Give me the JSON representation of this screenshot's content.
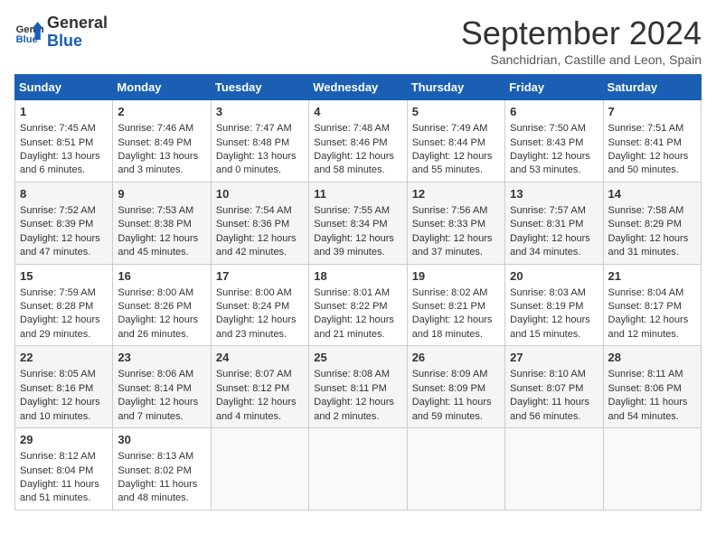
{
  "header": {
    "logo_line1": "General",
    "logo_line2": "Blue",
    "month_title": "September 2024",
    "subtitle": "Sanchidrian, Castille and Leon, Spain"
  },
  "days_of_week": [
    "Sunday",
    "Monday",
    "Tuesday",
    "Wednesday",
    "Thursday",
    "Friday",
    "Saturday"
  ],
  "weeks": [
    [
      {
        "day": "1",
        "sunrise": "Sunrise: 7:45 AM",
        "sunset": "Sunset: 8:51 PM",
        "daylight": "Daylight: 13 hours and 6 minutes."
      },
      {
        "day": "2",
        "sunrise": "Sunrise: 7:46 AM",
        "sunset": "Sunset: 8:49 PM",
        "daylight": "Daylight: 13 hours and 3 minutes."
      },
      {
        "day": "3",
        "sunrise": "Sunrise: 7:47 AM",
        "sunset": "Sunset: 8:48 PM",
        "daylight": "Daylight: 13 hours and 0 minutes."
      },
      {
        "day": "4",
        "sunrise": "Sunrise: 7:48 AM",
        "sunset": "Sunset: 8:46 PM",
        "daylight": "Daylight: 12 hours and 58 minutes."
      },
      {
        "day": "5",
        "sunrise": "Sunrise: 7:49 AM",
        "sunset": "Sunset: 8:44 PM",
        "daylight": "Daylight: 12 hours and 55 minutes."
      },
      {
        "day": "6",
        "sunrise": "Sunrise: 7:50 AM",
        "sunset": "Sunset: 8:43 PM",
        "daylight": "Daylight: 12 hours and 53 minutes."
      },
      {
        "day": "7",
        "sunrise": "Sunrise: 7:51 AM",
        "sunset": "Sunset: 8:41 PM",
        "daylight": "Daylight: 12 hours and 50 minutes."
      }
    ],
    [
      {
        "day": "8",
        "sunrise": "Sunrise: 7:52 AM",
        "sunset": "Sunset: 8:39 PM",
        "daylight": "Daylight: 12 hours and 47 minutes."
      },
      {
        "day": "9",
        "sunrise": "Sunrise: 7:53 AM",
        "sunset": "Sunset: 8:38 PM",
        "daylight": "Daylight: 12 hours and 45 minutes."
      },
      {
        "day": "10",
        "sunrise": "Sunrise: 7:54 AM",
        "sunset": "Sunset: 8:36 PM",
        "daylight": "Daylight: 12 hours and 42 minutes."
      },
      {
        "day": "11",
        "sunrise": "Sunrise: 7:55 AM",
        "sunset": "Sunset: 8:34 PM",
        "daylight": "Daylight: 12 hours and 39 minutes."
      },
      {
        "day": "12",
        "sunrise": "Sunrise: 7:56 AM",
        "sunset": "Sunset: 8:33 PM",
        "daylight": "Daylight: 12 hours and 37 minutes."
      },
      {
        "day": "13",
        "sunrise": "Sunrise: 7:57 AM",
        "sunset": "Sunset: 8:31 PM",
        "daylight": "Daylight: 12 hours and 34 minutes."
      },
      {
        "day": "14",
        "sunrise": "Sunrise: 7:58 AM",
        "sunset": "Sunset: 8:29 PM",
        "daylight": "Daylight: 12 hours and 31 minutes."
      }
    ],
    [
      {
        "day": "15",
        "sunrise": "Sunrise: 7:59 AM",
        "sunset": "Sunset: 8:28 PM",
        "daylight": "Daylight: 12 hours and 29 minutes."
      },
      {
        "day": "16",
        "sunrise": "Sunrise: 8:00 AM",
        "sunset": "Sunset: 8:26 PM",
        "daylight": "Daylight: 12 hours and 26 minutes."
      },
      {
        "day": "17",
        "sunrise": "Sunrise: 8:00 AM",
        "sunset": "Sunset: 8:24 PM",
        "daylight": "Daylight: 12 hours and 23 minutes."
      },
      {
        "day": "18",
        "sunrise": "Sunrise: 8:01 AM",
        "sunset": "Sunset: 8:22 PM",
        "daylight": "Daylight: 12 hours and 21 minutes."
      },
      {
        "day": "19",
        "sunrise": "Sunrise: 8:02 AM",
        "sunset": "Sunset: 8:21 PM",
        "daylight": "Daylight: 12 hours and 18 minutes."
      },
      {
        "day": "20",
        "sunrise": "Sunrise: 8:03 AM",
        "sunset": "Sunset: 8:19 PM",
        "daylight": "Daylight: 12 hours and 15 minutes."
      },
      {
        "day": "21",
        "sunrise": "Sunrise: 8:04 AM",
        "sunset": "Sunset: 8:17 PM",
        "daylight": "Daylight: 12 hours and 12 minutes."
      }
    ],
    [
      {
        "day": "22",
        "sunrise": "Sunrise: 8:05 AM",
        "sunset": "Sunset: 8:16 PM",
        "daylight": "Daylight: 12 hours and 10 minutes."
      },
      {
        "day": "23",
        "sunrise": "Sunrise: 8:06 AM",
        "sunset": "Sunset: 8:14 PM",
        "daylight": "Daylight: 12 hours and 7 minutes."
      },
      {
        "day": "24",
        "sunrise": "Sunrise: 8:07 AM",
        "sunset": "Sunset: 8:12 PM",
        "daylight": "Daylight: 12 hours and 4 minutes."
      },
      {
        "day": "25",
        "sunrise": "Sunrise: 8:08 AM",
        "sunset": "Sunset: 8:11 PM",
        "daylight": "Daylight: 12 hours and 2 minutes."
      },
      {
        "day": "26",
        "sunrise": "Sunrise: 8:09 AM",
        "sunset": "Sunset: 8:09 PM",
        "daylight": "Daylight: 11 hours and 59 minutes."
      },
      {
        "day": "27",
        "sunrise": "Sunrise: 8:10 AM",
        "sunset": "Sunset: 8:07 PM",
        "daylight": "Daylight: 11 hours and 56 minutes."
      },
      {
        "day": "28",
        "sunrise": "Sunrise: 8:11 AM",
        "sunset": "Sunset: 8:06 PM",
        "daylight": "Daylight: 11 hours and 54 minutes."
      }
    ],
    [
      {
        "day": "29",
        "sunrise": "Sunrise: 8:12 AM",
        "sunset": "Sunset: 8:04 PM",
        "daylight": "Daylight: 11 hours and 51 minutes."
      },
      {
        "day": "30",
        "sunrise": "Sunrise: 8:13 AM",
        "sunset": "Sunset: 8:02 PM",
        "daylight": "Daylight: 11 hours and 48 minutes."
      },
      null,
      null,
      null,
      null,
      null
    ]
  ]
}
